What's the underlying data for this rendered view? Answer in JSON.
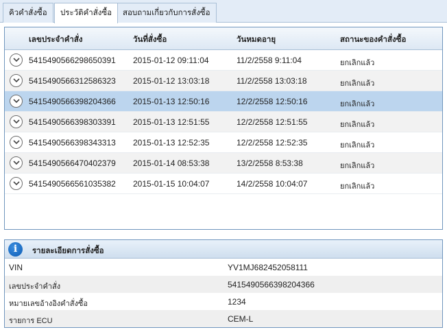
{
  "tabs": [
    {
      "label": "คิวคำสั่งซื้อ",
      "active": false
    },
    {
      "label": "ประวัติคำสั่งซื้อ",
      "active": true
    },
    {
      "label": "สอบถามเกี่ยวกับการสั่งซื้อ",
      "active": false
    }
  ],
  "grid": {
    "columns": [
      "เลขประจำคำสั่ง",
      "วันที่สั่งซื้อ",
      "วันหมดอายุ",
      "สถานะของคำสั่งซื้อ"
    ],
    "rows": [
      {
        "order_no": "5415490566298650391",
        "order_date": "2015-01-12 09:11:04",
        "expiry": "11/2/2558 9:11:04",
        "status": "ยกเลิกแล้ว"
      },
      {
        "order_no": "5415490566312586323",
        "order_date": "2015-01-12 13:03:18",
        "expiry": "11/2/2558 13:03:18",
        "status": "ยกเลิกแล้ว"
      },
      {
        "order_no": "5415490566398204366",
        "order_date": "2015-01-13 12:50:16",
        "expiry": "12/2/2558 12:50:16",
        "status": "ยกเลิกแล้ว"
      },
      {
        "order_no": "5415490566398303391",
        "order_date": "2015-01-13 12:51:55",
        "expiry": "12/2/2558 12:51:55",
        "status": "ยกเลิกแล้ว"
      },
      {
        "order_no": "5415490566398343313",
        "order_date": "2015-01-13 12:52:35",
        "expiry": "12/2/2558 12:52:35",
        "status": "ยกเลิกแล้ว"
      },
      {
        "order_no": "5415490566470402379",
        "order_date": "2015-01-14 08:53:38",
        "expiry": "13/2/2558 8:53:38",
        "status": "ยกเลิกแล้ว"
      },
      {
        "order_no": "5415490566561035382",
        "order_date": "2015-01-15 10:04:07",
        "expiry": "14/2/2558 10:04:07",
        "status": "ยกเลิกแล้ว"
      }
    ],
    "selected_index": 2
  },
  "details": {
    "icon": "info-icon",
    "icon_glyph": "i",
    "title": "รายละเอียดการสั่งซื้อ",
    "rows": [
      {
        "label": "VIN",
        "value": "YV1MJ682452058111"
      },
      {
        "label": "เลขประจำคำสั่ง",
        "value": "5415490566398204366"
      },
      {
        "label": "หมายเลขอ้างอิงคำสั่งซื้อ",
        "value": "1234"
      },
      {
        "label": "รายการ ECU",
        "value": "CEM-L"
      }
    ]
  },
  "colors": {
    "selected_row": "#bcd5ee",
    "border": "#6f95bd",
    "tab_bar": "#e3ecf7"
  }
}
